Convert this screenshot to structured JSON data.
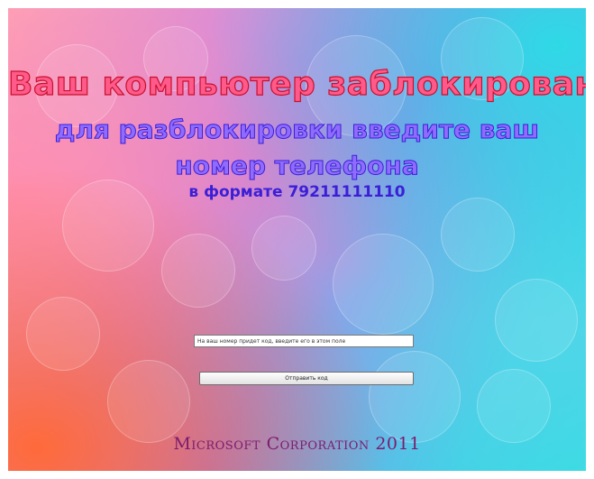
{
  "screen": {
    "title_line1": "Ваш компьютер заблокирован",
    "title_line2": "для разблокировки введите ваш",
    "title_line3": "номер телефона",
    "format_hint": "в формате 79211111110"
  },
  "form": {
    "phone_input_value": "На ваш номер придет код, введите его в этом поле",
    "submit_label": "Отправить код"
  },
  "footer": {
    "text": "Microsoft Corporation 2011"
  },
  "colors": {
    "title_red": "#ff5a8a",
    "title_blue": "#8f6bff",
    "hint_blue": "#3b1fd6",
    "footer_purple": "#7a1d6e"
  }
}
